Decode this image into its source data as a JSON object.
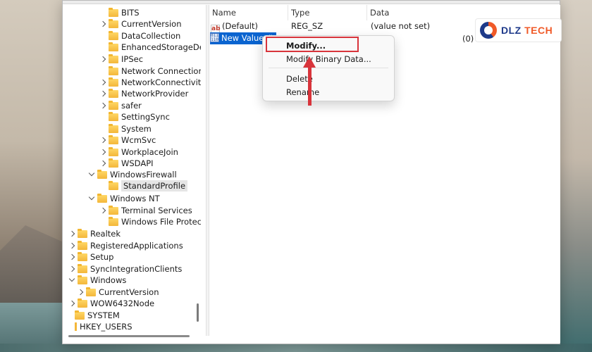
{
  "tree": {
    "items": [
      {
        "label": "BITS",
        "indent": 4,
        "chevron": "none"
      },
      {
        "label": "CurrentVersion",
        "indent": 4,
        "chevron": "right"
      },
      {
        "label": "DataCollection",
        "indent": 4,
        "chevron": "none"
      },
      {
        "label": "EnhancedStorageDe",
        "indent": 4,
        "chevron": "none"
      },
      {
        "label": "IPSec",
        "indent": 4,
        "chevron": "right"
      },
      {
        "label": "Network Connection",
        "indent": 4,
        "chevron": "none"
      },
      {
        "label": "NetworkConnectivity",
        "indent": 4,
        "chevron": "right"
      },
      {
        "label": "NetworkProvider",
        "indent": 4,
        "chevron": "right"
      },
      {
        "label": "safer",
        "indent": 4,
        "chevron": "right"
      },
      {
        "label": "SettingSync",
        "indent": 4,
        "chevron": "none"
      },
      {
        "label": "System",
        "indent": 4,
        "chevron": "none"
      },
      {
        "label": "WcmSvc",
        "indent": 4,
        "chevron": "right"
      },
      {
        "label": "WorkplaceJoin",
        "indent": 4,
        "chevron": "right"
      },
      {
        "label": "WSDAPI",
        "indent": 4,
        "chevron": "right"
      },
      {
        "label": "WindowsFirewall",
        "indent": 3,
        "chevron": "down"
      },
      {
        "label": "StandardProfile",
        "indent": 4,
        "chevron": "none",
        "selected": true
      },
      {
        "label": "Windows NT",
        "indent": 3,
        "chevron": "down"
      },
      {
        "label": "Terminal Services",
        "indent": 4,
        "chevron": "right"
      },
      {
        "label": "Windows File Protec",
        "indent": 4,
        "chevron": "none"
      },
      {
        "label": "Realtek",
        "indent": 1,
        "chevron": "right"
      },
      {
        "label": "RegisteredApplications",
        "indent": 1,
        "chevron": "right"
      },
      {
        "label": "Setup",
        "indent": 1,
        "chevron": "right"
      },
      {
        "label": "SyncIntegrationClients",
        "indent": 1,
        "chevron": "right"
      },
      {
        "label": "Windows",
        "indent": 1,
        "chevron": "down"
      },
      {
        "label": "CurrentVersion",
        "indent": 2,
        "chevron": "right"
      },
      {
        "label": "WOW6432Node",
        "indent": 1,
        "chevron": "right"
      },
      {
        "label": "SYSTEM",
        "indent": 0,
        "chevron": "none"
      },
      {
        "label": "HKEY_USERS",
        "indent": 0,
        "chevron": "none",
        "root": true
      }
    ]
  },
  "columns": {
    "name": "Name",
    "type": "Type",
    "data": "Data"
  },
  "values": {
    "default": {
      "name": "(Default)",
      "type": "REG_SZ",
      "data": "(value not set)",
      "icon": "ab-icon"
    },
    "new_value": {
      "name": "New Value #",
      "data": "(0)",
      "icon": "binary-icon"
    }
  },
  "context_menu": {
    "modify": "Modify...",
    "modify_binary": "Modify Binary Data...",
    "delete": "Delete",
    "rename": "Rename"
  },
  "logo": {
    "brand_main": "DLZ",
    "brand_accent": "TECH"
  },
  "colors": {
    "selection": "#0a64d0",
    "annotation": "#d8343b",
    "folder": "#f4b73a"
  }
}
